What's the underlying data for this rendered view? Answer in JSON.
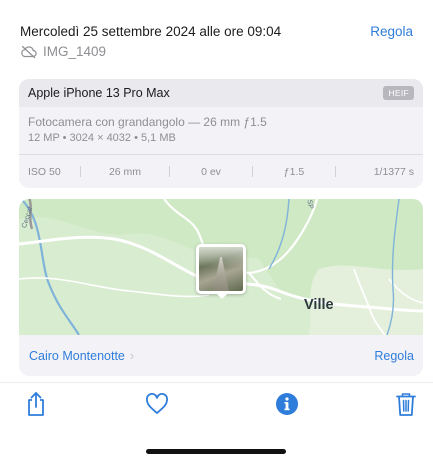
{
  "header": {
    "date": "Mercoledì 25 settembre 2024 alle ore 09:04",
    "adjust_label": "Regola",
    "cloud_icon": "cloud-off-icon",
    "filename": "IMG_1409"
  },
  "camera": {
    "device": "Apple iPhone 13 Pro Max",
    "format": "HEIF",
    "lens": "Fotocamera con grandangolo — 26 mm ƒ1.5",
    "specs": "12 MP  •  3024 × 4032  •  5,1 MB",
    "exif": {
      "iso": "ISO 50",
      "focal": "26 mm",
      "exposure": "0 ev",
      "aperture": "ƒ1.5",
      "shutter": "1/1377 s"
    }
  },
  "map": {
    "place": "Ville",
    "road_label_left": "Ceccaf",
    "road_label_right": "SP",
    "location": "Cairo Montenotte",
    "adjust_label": "Regola"
  },
  "toolbar": {
    "share_icon": "share-icon",
    "like_icon": "heart-icon",
    "info_icon": "info-icon",
    "delete_icon": "trash-icon"
  },
  "colors": {
    "accent": "#2f7ddb",
    "secondary_text": "#8e8e93",
    "map_land": "#cfe9c4",
    "map_road": "#ffffff",
    "map_water": "#7fb3d9"
  }
}
